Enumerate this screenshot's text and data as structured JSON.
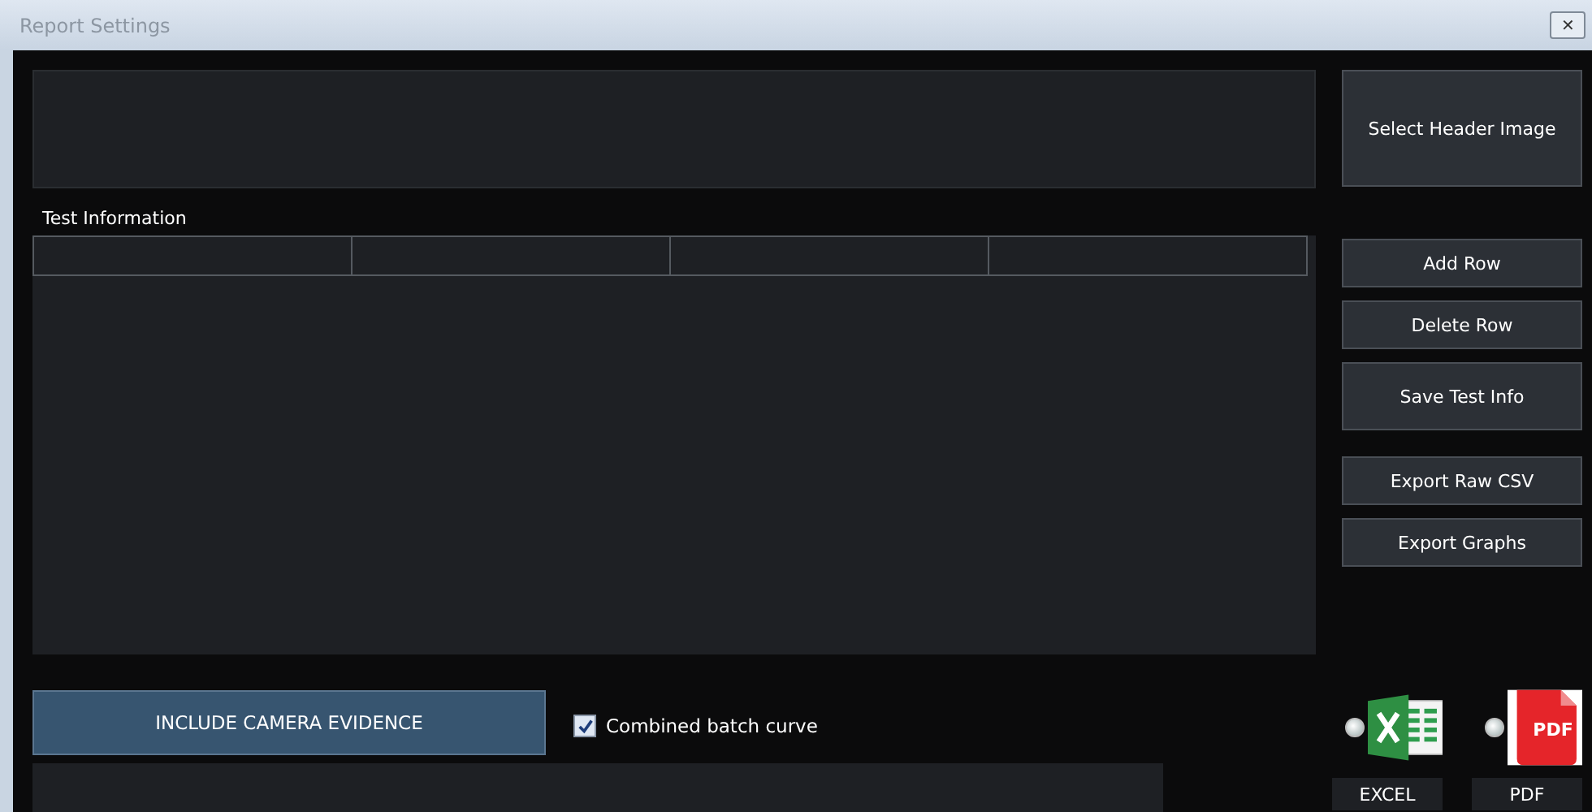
{
  "window": {
    "title": "Report Settings",
    "close": "✕"
  },
  "test_information": {
    "label": "Test Information"
  },
  "side_buttons": [
    {
      "label": "Select Header Image",
      "kind": "tall"
    },
    {
      "label": "Add Row",
      "kind": "short"
    },
    {
      "label": "Delete Row",
      "kind": "short"
    },
    {
      "label": "Save Test Info",
      "kind": "medium"
    },
    {
      "label": "Export Raw CSV",
      "kind": "short"
    },
    {
      "label": "Export Graphs",
      "kind": "short"
    }
  ],
  "camera_button": "INCLUDE CAMERA EVIDENCE",
  "combined_batch_curve": {
    "label": "Combined batch curve",
    "checked": true
  },
  "export_formats": [
    {
      "kind": "excel",
      "label": "EXCEL",
      "selected": false
    },
    {
      "kind": "pdf",
      "label": "PDF",
      "icon_text": "PDF",
      "selected": false
    }
  ]
}
